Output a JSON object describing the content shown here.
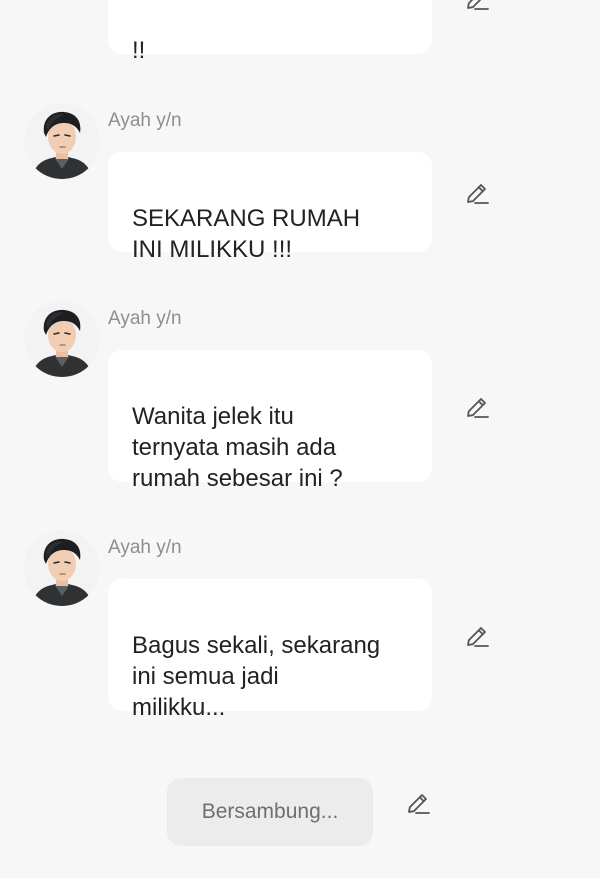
{
  "messages": [
    {
      "sender": "",
      "text": "!!"
    },
    {
      "sender": "Ayah y/n",
      "text": "SEKARANG RUMAH\nINI MILIKKU !!!"
    },
    {
      "sender": "Ayah y/n",
      "text": "Wanita jelek itu\nternyata masih ada\nrumah sebesar ini ?"
    },
    {
      "sender": "Ayah y/n",
      "text": "Bagus sekali, sekarang\nini semua jadi\nmilikku..."
    }
  ],
  "footer": {
    "continue_label": "Bersambung..."
  },
  "icons": {
    "edit": "pencil-edit-icon",
    "avatar": "character-avatar"
  },
  "colors": {
    "background": "#f7f7f7",
    "bubble": "#ffffff",
    "sender_name": "#8e8e8e",
    "continue_pill": "#ececec"
  }
}
